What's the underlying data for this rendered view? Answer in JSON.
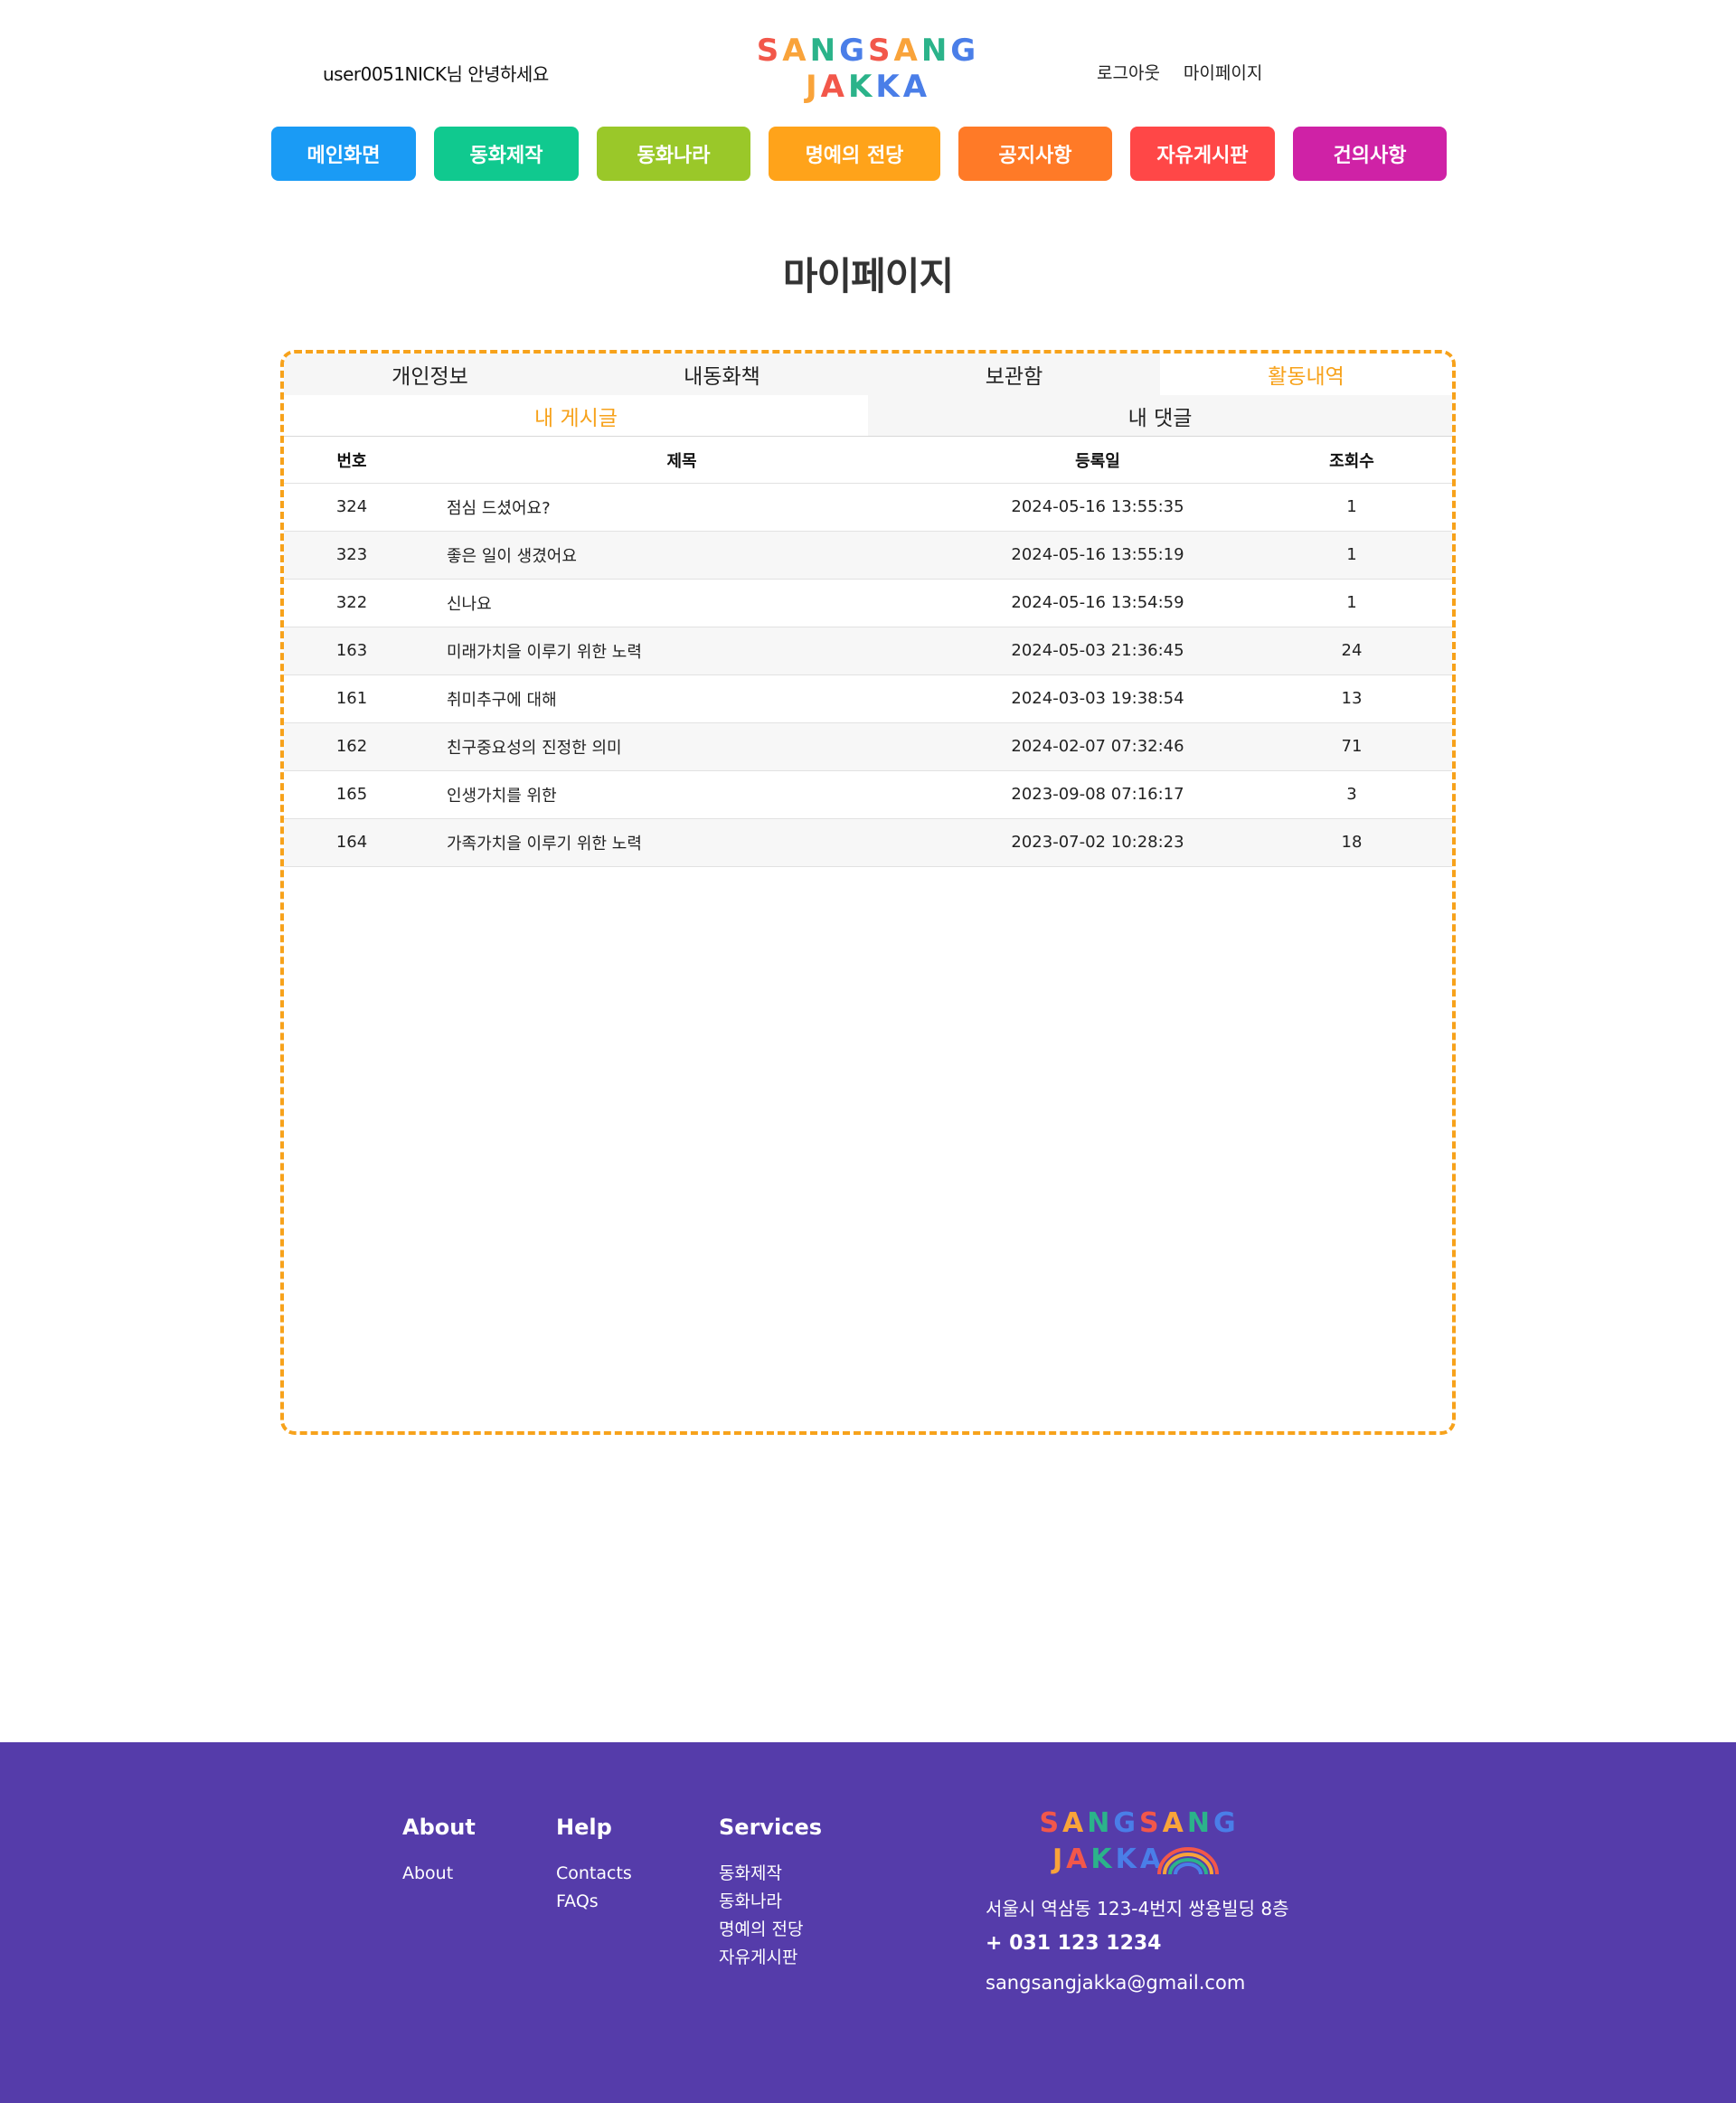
{
  "header": {
    "greeting": "user0051NICK님 안녕하세요",
    "logo_line1": [
      "S",
      "A",
      "N",
      "G",
      "S",
      "A",
      "N",
      "G"
    ],
    "logo_line2": [
      "J",
      "A",
      "K",
      "K",
      "A"
    ],
    "logo_colors1": [
      "#f2574a",
      "#f9a33a",
      "#2bb38a",
      "#4a7ee8",
      "#f2574a",
      "#f9a33a",
      "#2bb38a",
      "#4a7ee8"
    ],
    "logo_colors2": [
      "#f9a33a",
      "#f2574a",
      "#2bb38a",
      "#4a7ee8",
      "#4a7ee8"
    ],
    "logout": "로그아웃",
    "mypage": "마이페이지"
  },
  "nav": [
    {
      "label": "메인화면",
      "color": "#1a9bf5"
    },
    {
      "label": "동화제작",
      "color": "#10c98f"
    },
    {
      "label": "동화나라",
      "color": "#9ac829"
    },
    {
      "label": "명예의 전당",
      "color": "#ffa31a"
    },
    {
      "label": "공지사항",
      "color": "#ff7a27"
    },
    {
      "label": "자유게시판",
      "color": "#ff4747"
    },
    {
      "label": "건의사항",
      "color": "#cf22a6"
    }
  ],
  "page_title": "마이페이지",
  "tabs": {
    "main": [
      "개인정보",
      "내동화책",
      "보관함",
      "활동내역"
    ],
    "main_active": 3,
    "sub": [
      "내 게시글",
      "내 댓글"
    ],
    "sub_active": 0
  },
  "table": {
    "headers": {
      "num": "번호",
      "title": "제목",
      "date": "등록일",
      "views": "조회수"
    },
    "rows": [
      {
        "num": "324",
        "title": "점심 드셨어요?",
        "date": "2024-05-16 13:55:35",
        "views": "1"
      },
      {
        "num": "323",
        "title": "좋은 일이 생겼어요",
        "date": "2024-05-16 13:55:19",
        "views": "1"
      },
      {
        "num": "322",
        "title": "신나요",
        "date": "2024-05-16 13:54:59",
        "views": "1"
      },
      {
        "num": "163",
        "title": "미래가치을 이루기 위한 노력",
        "date": "2024-05-03 21:36:45",
        "views": "24"
      },
      {
        "num": "161",
        "title": "취미추구에 대해",
        "date": "2024-03-03 19:38:54",
        "views": "13"
      },
      {
        "num": "162",
        "title": "친구중요성의 진정한 의미",
        "date": "2024-02-07 07:32:46",
        "views": "71"
      },
      {
        "num": "165",
        "title": "인생가치를 위한",
        "date": "2023-09-08 07:16:17",
        "views": "3"
      },
      {
        "num": "164",
        "title": "가족가치을 이루기 위한 노력",
        "date": "2023-07-02 10:28:23",
        "views": "18"
      }
    ]
  },
  "footer": {
    "about": {
      "heading": "About",
      "links": [
        "About"
      ]
    },
    "help": {
      "heading": "Help",
      "links": [
        "Contacts",
        "FAQs"
      ]
    },
    "services": {
      "heading": "Services",
      "links": [
        "동화제작",
        "동화나라",
        "명예의 전당",
        "자유게시판"
      ]
    },
    "address": "서울시 역삼동 123-4번지 쌍용빌딩 8층",
    "phone": "+ 031 123 1234",
    "email": "sangsangjakka@gmail.com"
  }
}
